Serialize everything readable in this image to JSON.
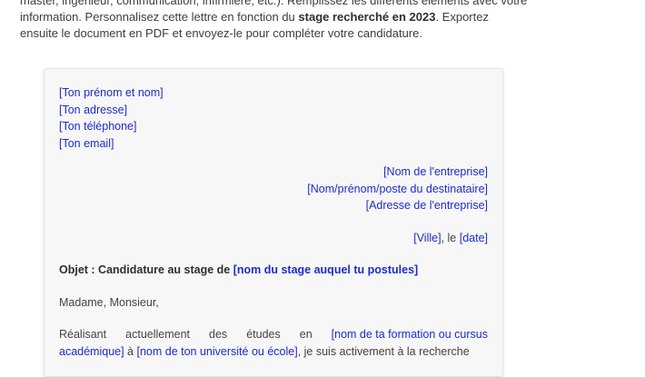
{
  "intro": {
    "line1": "master, ingénieur, communication, infirmière, etc.). Remplissez les différents éléments avec votre",
    "line2_pre": "information. Personnalisez cette lettre en fonction du ",
    "line2_bold": "stage recherché en 2023",
    "line2_post": ". Exportez",
    "line3": "ensuite le document en PDF et envoyez-le pour compléter votre candidature."
  },
  "letter": {
    "sender": {
      "name": "[Ton prénom et nom]",
      "address": "[Ton adresse]",
      "phone": "[Ton téléphone]",
      "email": "[Ton email]"
    },
    "recipient": {
      "company": "[Nom de l'entreprise]",
      "person": "[Nom/prénom/poste du destinataire]",
      "address": "[Adresse de l'entreprise]"
    },
    "date": {
      "city": "[Ville]",
      "sep": ", le ",
      "date": "[date]"
    },
    "subject": {
      "label": "Objet : Candidature au stage de ",
      "value": "[nom du stage auquel tu postules]"
    },
    "greeting": "Madame, Monsieur,",
    "body": {
      "l1_w1": "Réalisant",
      "l1_w2": "actuellement",
      "l1_w3": "des",
      "l1_w4": "études",
      "l1_w5": "en",
      "l1_ph": "[nom de ta formation ou cursus",
      "l2_ph1": "académique]",
      "l2_t1": " à ",
      "l2_ph2": "[nom de ton université ou école]",
      "l2_t2": ", je suis activement à la recherche"
    }
  }
}
